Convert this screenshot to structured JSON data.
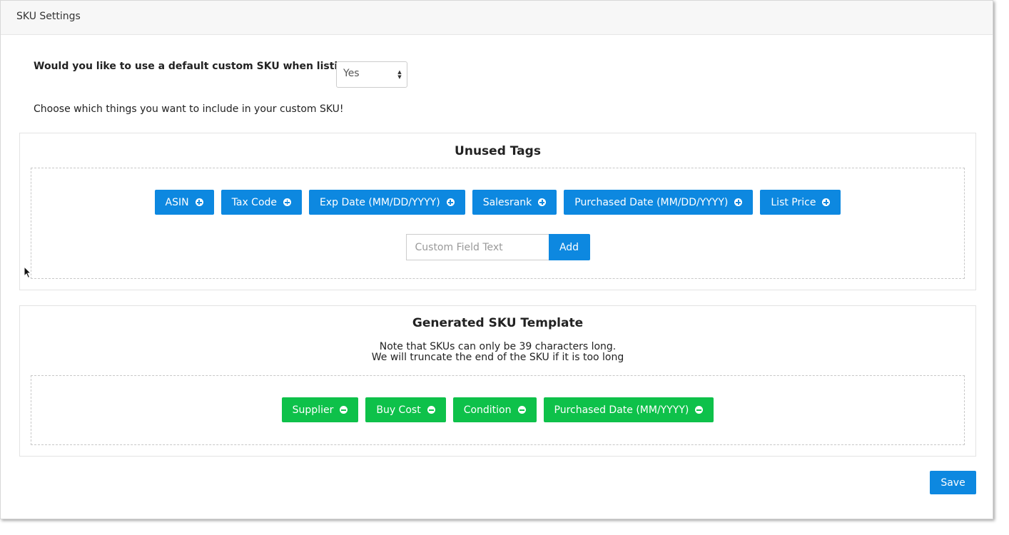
{
  "header": {
    "title": "SKU Settings"
  },
  "question": {
    "label": "Would you like to use a default custom SKU when listing?",
    "selected": "Yes"
  },
  "instructions": "Choose which things you want to include in your custom SKU!",
  "unused": {
    "title": "Unused Tags",
    "tags": [
      "ASIN",
      "Tax Code",
      "Exp Date (MM/DD/YYYY)",
      "Salesrank",
      "Purchased Date (MM/DD/YYYY)",
      "List Price"
    ],
    "custom_placeholder": "Custom Field Text",
    "add_label": "Add"
  },
  "template": {
    "title": "Generated SKU Template",
    "note_line1": "Note that SKUs can only be 39 characters long.",
    "note_line2": "We will truncate the end of the SKU if it is too long",
    "tags": [
      "Supplier",
      "Buy Cost",
      "Condition",
      "Purchased Date (MM/YYYY)"
    ]
  },
  "save_label": "Save",
  "colors": {
    "primary": "#0d88e0",
    "success": "#0ec14a"
  },
  "icons": {
    "add_tag": "plus-circle-icon",
    "remove_tag": "minus-circle-icon"
  }
}
